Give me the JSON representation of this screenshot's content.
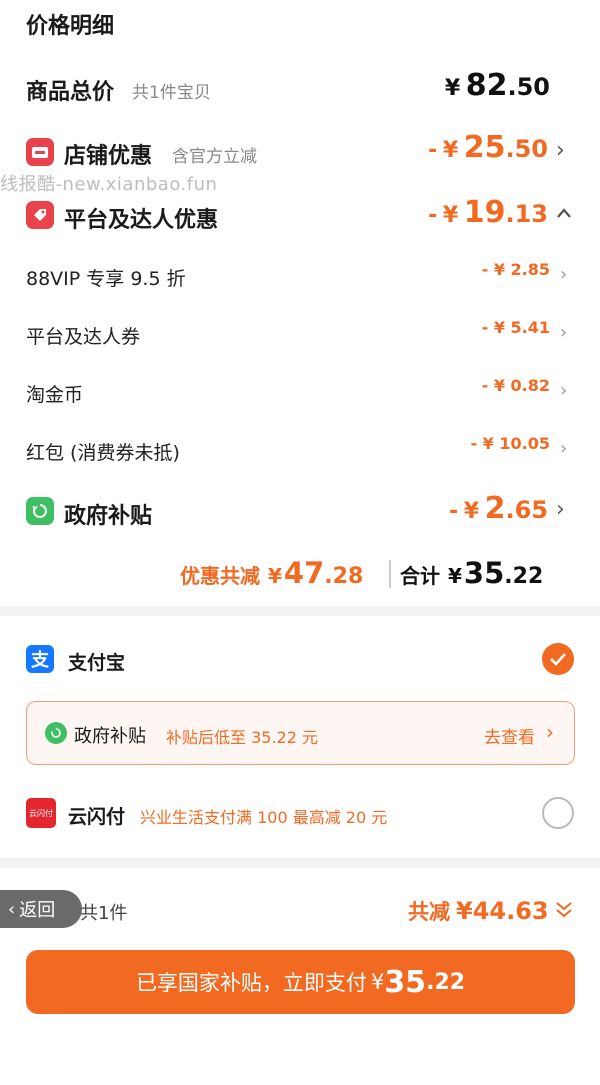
{
  "title": "价格明细",
  "watermark": "线报酷-new.xianbao.fun",
  "total_goods": {
    "label": "商品总价",
    "sub": "共1件宝贝",
    "symbol": "¥",
    "int": "82",
    "dec": ".50"
  },
  "shop_discount": {
    "label": "店铺优惠",
    "sub": "含官方立减",
    "prefix": "-",
    "symbol": "¥",
    "int": "25",
    "dec": ".50"
  },
  "platform_discount": {
    "label": "平台及达人优惠",
    "prefix": "-",
    "symbol": "¥",
    "int": "19",
    "dec": ".13"
  },
  "sub_items": [
    {
      "label": "88VIP 专享 9.5 折",
      "price": "- ¥ 2.85"
    },
    {
      "label": "平台及达人券",
      "price": "- ¥ 5.41"
    },
    {
      "label": "淘金币",
      "price": "- ¥ 0.82"
    },
    {
      "label": "红包 (消费券未抵)",
      "price": "- ¥ 10.05"
    }
  ],
  "gov_subsidy": {
    "label": "政府补贴",
    "prefix": "-",
    "symbol": "¥",
    "int": "2",
    "dec": ".65"
  },
  "summary": {
    "discount_label": "优惠共减",
    "discount_symbol": "¥",
    "discount_int": "47",
    "discount_dec": ".28",
    "total_label": "合计",
    "total_symbol": "¥",
    "total_int": "35",
    "total_dec": ".22"
  },
  "payment": {
    "alipay_label": "支付宝",
    "gov_box_label": "政府补贴",
    "gov_box_text": "补贴后低至 35.22 元",
    "gov_box_link": "去查看",
    "unionpay_label": "云闪付",
    "unionpay_logo_text": "云闪付",
    "unionpay_promo": "兴业生活支付满 100 最高减 20 元"
  },
  "bottom": {
    "back_label": "返回",
    "count_text": "共1件",
    "reduce_label": "共减",
    "reduce_value": "¥44.63",
    "button_text": "已享国家补贴，立即支付",
    "button_symbol": "¥",
    "button_int": "35",
    "button_dec": ".22"
  },
  "colors": {
    "accent": "#f26a22",
    "shop_icon": "#e8424a",
    "gov_icon": "#3fbf63",
    "alipay": "#1677ff"
  }
}
